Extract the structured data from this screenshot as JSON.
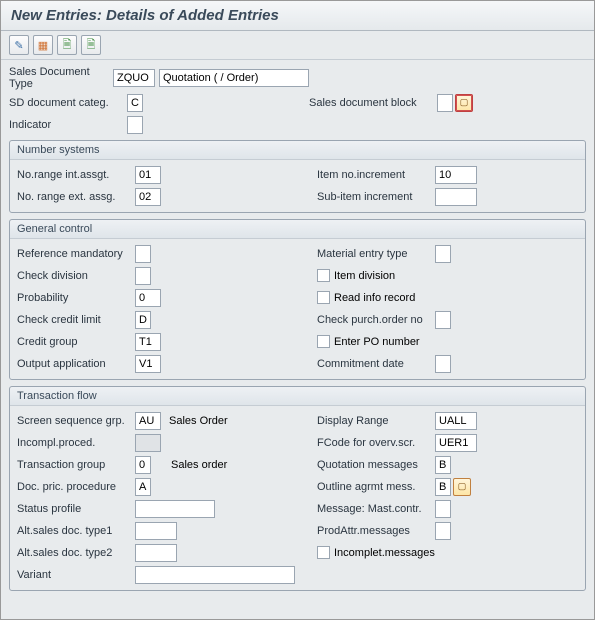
{
  "title": "New Entries: Details of Added Entries",
  "toolbar": {
    "config": "⚙",
    "delim": "▤",
    "prev": "◀",
    "next": "▶"
  },
  "top": {
    "sales_doc_type_label": "Sales Document Type",
    "sales_doc_type_value": "ZQUO",
    "sales_doc_type_desc": "Quotation ( / Order)",
    "sd_doc_categ_label": "SD document categ.",
    "sd_doc_categ_value": "C",
    "sales_doc_block_label": "Sales document block",
    "sales_doc_block_value": "",
    "indicator_label": "Indicator",
    "indicator_value": ""
  },
  "number_systems": {
    "title": "Number systems",
    "no_range_int_label": "No.range int.assgt.",
    "no_range_int_value": "01",
    "item_no_incr_label": "Item no.increment",
    "item_no_incr_value": "10",
    "no_range_ext_label": "No. range ext. assg.",
    "no_range_ext_value": "02",
    "sub_item_incr_label": "Sub-item increment",
    "sub_item_incr_value": ""
  },
  "general_control": {
    "title": "General control",
    "ref_mandatory_label": "Reference mandatory",
    "ref_mandatory_value": "",
    "material_entry_label": "Material entry type",
    "material_entry_value": "",
    "check_division_label": "Check division",
    "check_division_value": "",
    "item_division_label": "Item division",
    "probability_label": "Probability",
    "probability_value": "0",
    "read_info_label": "Read info record",
    "check_credit_label": "Check credit limit",
    "check_credit_value": "D",
    "check_po_label": "Check purch.order no",
    "check_po_value": "",
    "credit_group_label": "Credit group",
    "credit_group_value": "T1",
    "enter_po_label": "Enter PO number",
    "output_app_label": "Output application",
    "output_app_value": "V1",
    "commitment_label": "Commitment  date",
    "commitment_value": ""
  },
  "transaction_flow": {
    "title": "Transaction flow",
    "screen_seq_label": "Screen sequence grp.",
    "screen_seq_value": "AU",
    "screen_seq_desc": "Sales Order",
    "display_range_label": "Display Range",
    "display_range_value": "UALL",
    "incompl_proc_label": "Incompl.proced.",
    "incompl_proc_value": "",
    "fcode_label": "FCode for overv.scr.",
    "fcode_value": "UER1",
    "trans_group_label": "Transaction group",
    "trans_group_value": "0",
    "trans_group_desc": "Sales order",
    "quotation_msg_label": "Quotation messages",
    "quotation_msg_value": "B",
    "doc_pric_label": "Doc. pric. procedure",
    "doc_pric_value": "A",
    "outline_label": "Outline agrmt mess.",
    "outline_value": "B",
    "status_profile_label": "Status profile",
    "status_profile_value": "",
    "message_mast_label": "Message: Mast.contr.",
    "message_mast_value": "",
    "alt_sales1_label": "Alt.sales doc. type1",
    "alt_sales1_value": "",
    "prodattr_label": "ProdAttr.messages",
    "prodattr_value": "",
    "alt_sales2_label": "Alt.sales doc. type2",
    "alt_sales2_value": "",
    "incomplet_msg_label": "Incomplet.messages",
    "variant_label": "Variant",
    "variant_value": ""
  }
}
